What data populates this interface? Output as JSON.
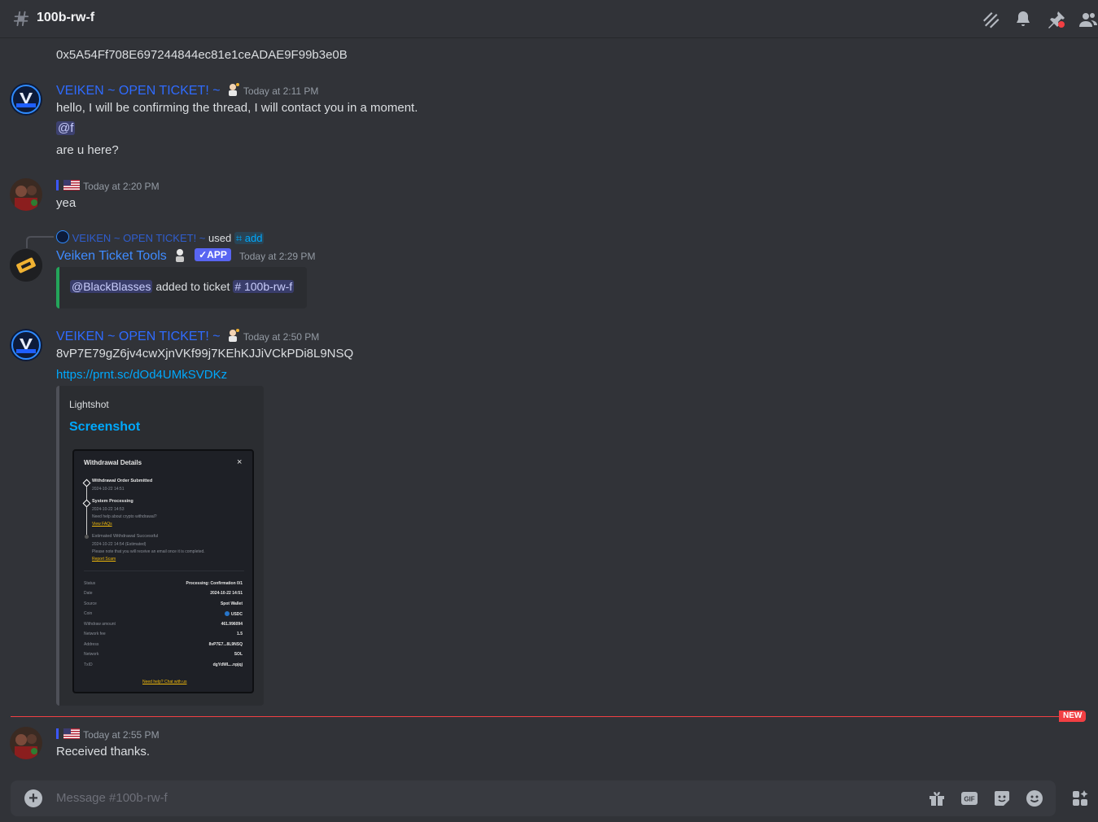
{
  "header": {
    "channel_name": "100b-rw-f"
  },
  "messages": {
    "m0": {
      "text": "0x5A54Ff708E697244844ec81e1ceADAE9F99b3e0B"
    },
    "m1": {
      "author": "VEIKEN ~ OPEN TICKET! ~",
      "timestamp": "Today at 2:11 PM",
      "line1": "hello, I will be confirming the thread, I will contact you in a moment.",
      "mention": "@f",
      "line2": "are u here?"
    },
    "m2": {
      "timestamp": "Today at 2:20 PM",
      "text": "yea"
    },
    "m3": {
      "reply_author": "VEIKEN ~ OPEN TICKET! ~",
      "reply_used": "used",
      "reply_command": "add",
      "author": "Veiken Ticket Tools",
      "badge": "APP",
      "timestamp": "Today at 2:29 PM",
      "embed_mention": "@BlackBlasses",
      "embed_text": "added to ticket",
      "embed_channel": "# 100b-rw-f"
    },
    "m4": {
      "author": "VEIKEN ~ OPEN TICKET! ~",
      "timestamp": "Today at 2:50 PM",
      "text": "8vP7E79gZ6jv4cwXjnVKf99j7KEhKJJiVCkPDi8L9NSQ",
      "link": "https://prnt.sc/dOd4UMkSVDKz",
      "embed_provider": "Lightshot",
      "embed_title": "Screenshot",
      "screenshot": {
        "title": "Withdrawal Details",
        "close": "×",
        "steps": [
          {
            "title": "Withdrawal Order Submitted",
            "date": "2024-10-22 14:51"
          },
          {
            "title": "System Processing",
            "date": "2024-10-22 14:53",
            "note": "Need help about crypto withdrawal?",
            "link": "View FAQs"
          },
          {
            "title": "Estimated Withdrawal Successful",
            "date": "2024-10-22 14:54 (Estimated)",
            "note": "Please note that you will receive an email once it is completed.",
            "link": "Report Scam"
          }
        ],
        "rows": [
          {
            "label": "Status",
            "value": "Processing: Confirmation 0/1"
          },
          {
            "label": "Date",
            "value": "2024-10-22 14:51"
          },
          {
            "label": "Source",
            "value": "Spot Wallet"
          },
          {
            "label": "Coin",
            "value": "USDC"
          },
          {
            "label": "Withdraw amount",
            "value": "461.996094"
          },
          {
            "label": "Network fee",
            "value": "1.5"
          },
          {
            "label": "Address",
            "value": "8vP7E7...8L9NSQ"
          },
          {
            "label": "Network",
            "value": "SOL"
          },
          {
            "label": "TxID",
            "value": "dgYdWL...npjqj"
          }
        ],
        "footer_link": "Need help? Chat with us"
      }
    },
    "m5": {
      "timestamp": "Today at 2:55 PM",
      "text": "Received thanks."
    }
  },
  "divider": {
    "label": "NEW"
  },
  "composer": {
    "placeholder": "Message #100b-rw-f"
  },
  "colors": {
    "background": "#313338",
    "username": "#2f6bff",
    "link": "#00a8fc",
    "new_divider": "#f23f43",
    "embed_bar": "#23a55a"
  }
}
